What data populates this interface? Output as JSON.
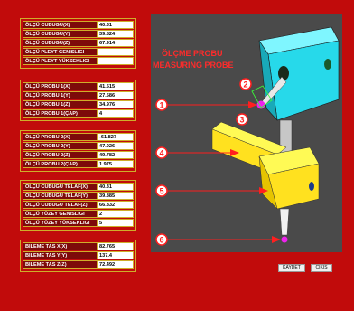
{
  "panel1": [
    {
      "label": "ÖLÇÜ CUBUGU(X)",
      "value": "40.31"
    },
    {
      "label": "ÖLÇÜ CUBUGU(Y)",
      "value": "39.824"
    },
    {
      "label": "ÖLÇÜ CUBUGU(Z)",
      "value": "67.914"
    },
    {
      "label": "ÖLÇÜ PLEYT GENISLIGI",
      "value": ""
    },
    {
      "label": "ÖLÇÜ PLEYT YÜKSEKLIGI",
      "value": ""
    }
  ],
  "panel2": [
    {
      "label": "ÖLÇÜ PROBU 1(X)",
      "value": "41.515"
    },
    {
      "label": "ÖLÇÜ PROBU 1(Y)",
      "value": "27.586"
    },
    {
      "label": "ÖLÇÜ PROBU 1(Z)",
      "value": "34.976"
    },
    {
      "label": "ÖLÇÜ PROBU 1(ÇAP)",
      "value": "4"
    }
  ],
  "panel3": [
    {
      "label": "ÖLÇÜ PROBU 2(X)",
      "value": "-61.827"
    },
    {
      "label": "ÖLÇÜ PROBU 2(Y)",
      "value": "47.026"
    },
    {
      "label": "ÖLÇÜ PROBU 2(Z)",
      "value": "49.782"
    },
    {
      "label": "ÖLÇÜ PROBU 2(ÇAP)",
      "value": "1.975"
    }
  ],
  "panel4": [
    {
      "label": "ÖLÇÜ CUBUGU TELAF(X)",
      "value": "40.31"
    },
    {
      "label": "ÖLÇÜ CUBUGU TELAF(Y)",
      "value": "39.885"
    },
    {
      "label": "ÖLÇÜ CUBUGU TELAF(Z)",
      "value": "66.832"
    },
    {
      "label": "ÖLÇÜ YÜZEY GENISLIGI",
      "value": "2"
    },
    {
      "label": "ÖLÇÜ YÜZEY YÜKSEKLIGI",
      "value": "5"
    }
  ],
  "panel5": [
    {
      "label": "BILEME TAS X(X)",
      "value": "82.765"
    },
    {
      "label": "BILEME TAS Y(Y)",
      "value": "137.4"
    },
    {
      "label": "BILEME TAS Z(Z)",
      "value": "72.492"
    }
  ],
  "diagram": {
    "title_tr": "ÖLÇME PROBU",
    "title_en": "MEASURING PROBE",
    "markers": [
      "1",
      "2",
      "3",
      "4",
      "5",
      "6"
    ]
  },
  "buttons": {
    "save": "KAYDET",
    "exit": "ÇIKIŞ"
  }
}
